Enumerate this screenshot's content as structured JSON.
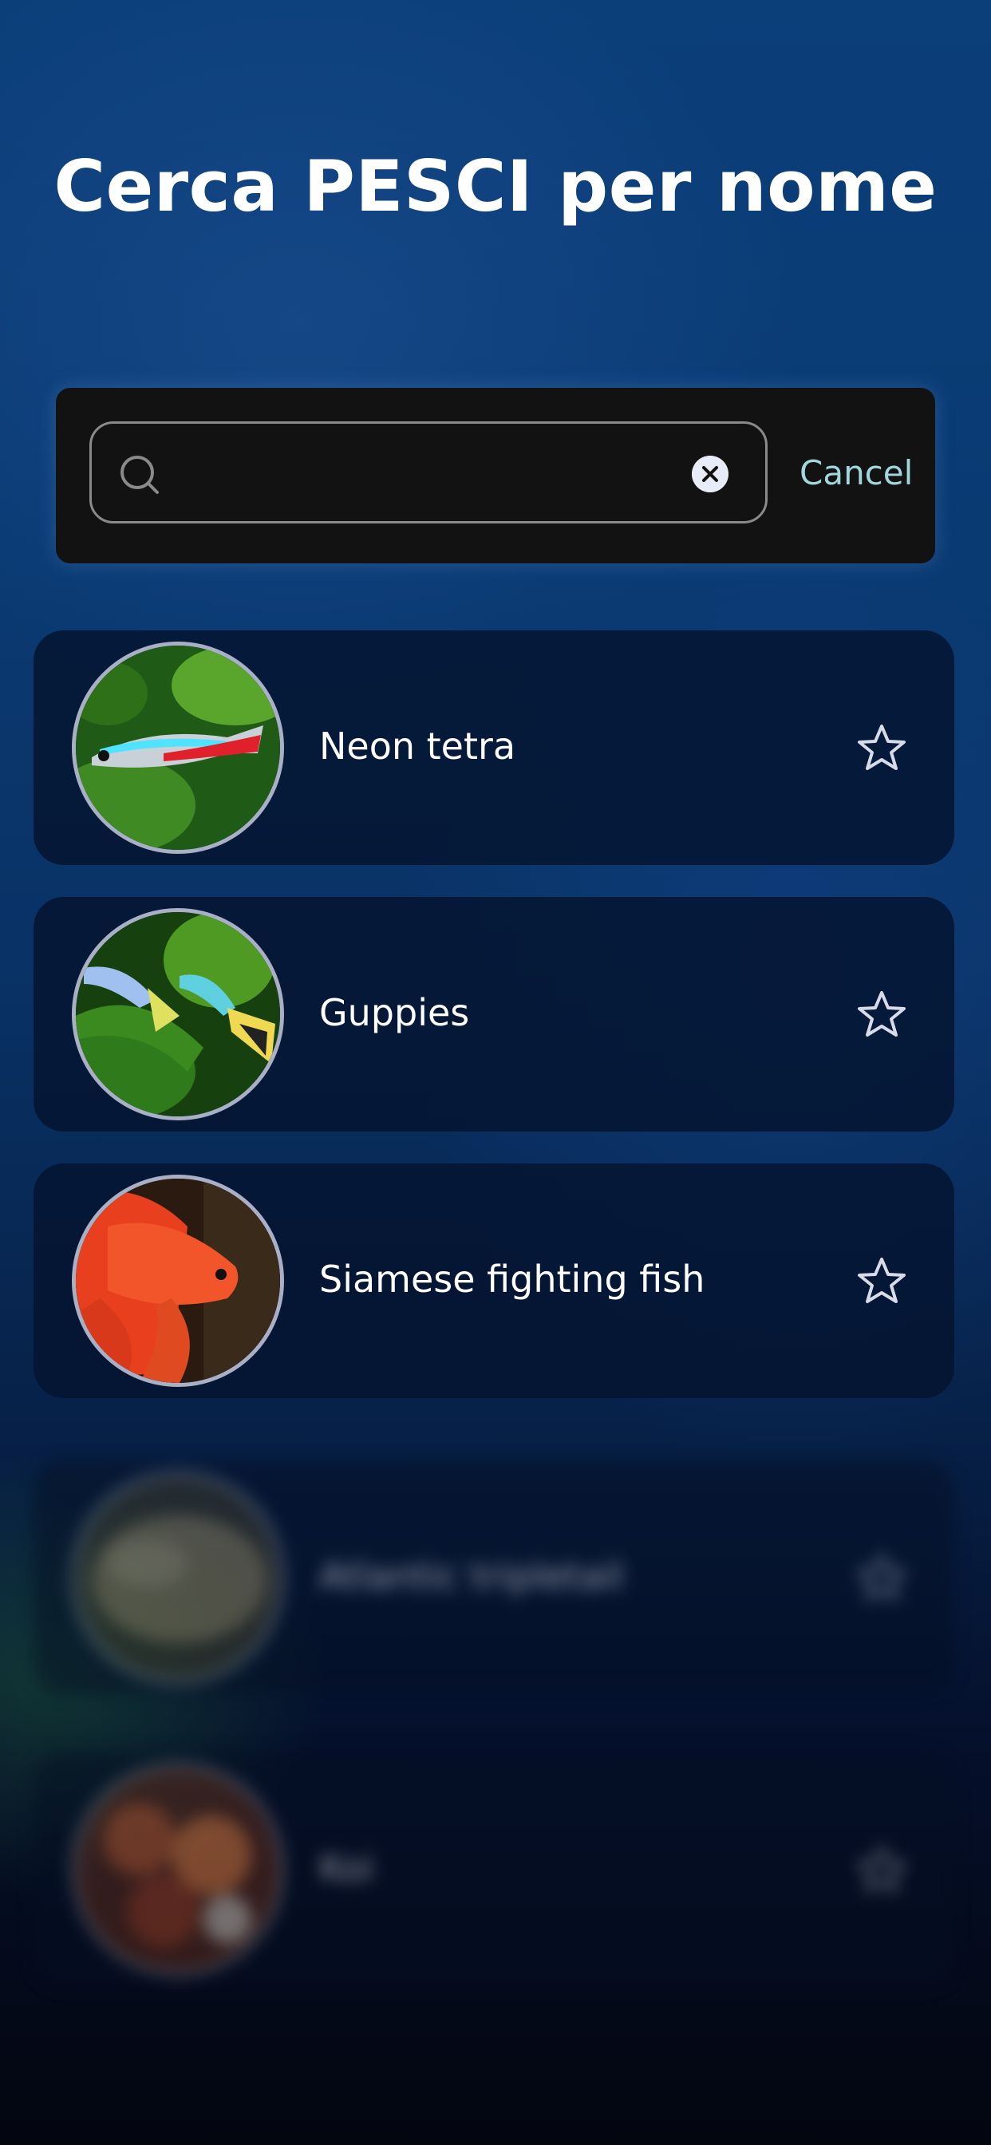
{
  "header": {
    "title": "Cerca PESCI per nome"
  },
  "search": {
    "placeholder": "",
    "value": "",
    "cancel_label": "Cancel"
  },
  "results": [
    {
      "name": "Neon tetra"
    },
    {
      "name": "Guppies"
    },
    {
      "name": "Siamese fighting fish"
    },
    {
      "name": "Atlantic tripletail"
    },
    {
      "name": "Koi"
    }
  ],
  "icons": {
    "search": "search-icon",
    "clear": "close-circle-icon",
    "favorite": "star-outline-icon"
  },
  "colors": {
    "accent": "#9fd7dc",
    "panel": "#121212",
    "card": "#051430"
  }
}
